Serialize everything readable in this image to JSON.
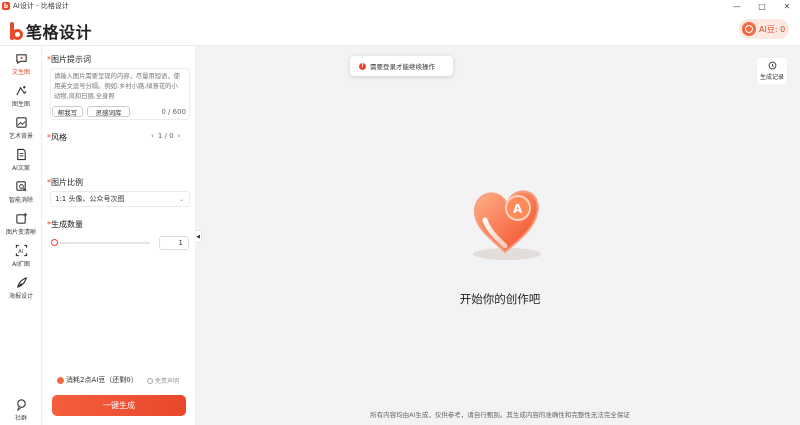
{
  "window": {
    "title": "AI设计 - 比格设计",
    "controls": [
      "—",
      "□",
      "✕"
    ]
  },
  "header": {
    "brand_name": "笔格设计",
    "bean_label": "AI豆: 0"
  },
  "nav": [
    {
      "label": "文生图",
      "icon": "chat-bubble-icon",
      "active": true
    },
    {
      "label": "图生图",
      "icon": "image-edit-icon",
      "active": false
    },
    {
      "label": "艺术背景",
      "icon": "art-background-icon",
      "active": false
    },
    {
      "label": "AI文案",
      "icon": "document-ai-icon",
      "active": false
    },
    {
      "label": "智能消除",
      "icon": "smart-erase-icon",
      "active": false
    },
    {
      "label": "图片变清晰",
      "icon": "image-enhance-icon",
      "active": false
    },
    {
      "label": "AI扩图",
      "icon": "image-expand-icon",
      "active": false
    },
    {
      "label": "海报设计",
      "icon": "pen-icon",
      "active": false
    }
  ],
  "community_label": "社群",
  "panel": {
    "prompt_label": "图片提示词",
    "prompt_placeholder": "请输入图片需要呈现的内容，尽量用短语，使用英文逗号分隔。例如:乡村小路,绿意花的小动物,风和日丽,全身照",
    "help_write": "帮我写",
    "inspiration": "灵感词库",
    "char_count": "0 / 600",
    "style_label": "风格",
    "style_page": "1 / 0",
    "ratio_label": "图片比例",
    "ratio_value": "1:1 头像、公众号次图",
    "count_label": "生成数量",
    "count_value": "1",
    "count_level": 1,
    "consume_text": "消耗2点AI豆（还剩0）",
    "free_text": "免责声明",
    "generate_button": "一键生成"
  },
  "main": {
    "toast": "需要登录才能继续操作",
    "history_label": "生成记录",
    "empty_title": "开始你的创作吧",
    "footer_note": "所有内容均由AI生成，仅供参考，请自行甄别。其生成内容的准确性和完整性无法完全保证"
  },
  "colors": {
    "accent": "#e9482b",
    "accent_light": "#fde8e2",
    "background": "#f3f3f5"
  }
}
